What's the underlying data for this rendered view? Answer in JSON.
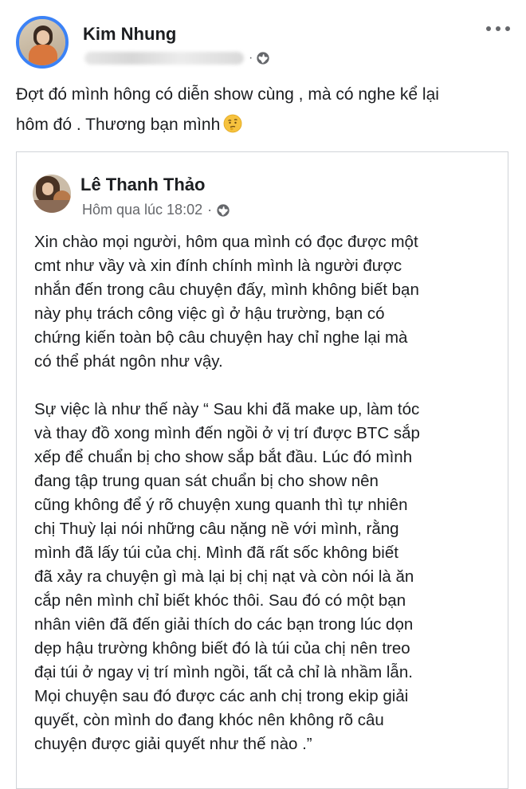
{
  "post": {
    "author": "Kim Nhung",
    "dot": "·",
    "text_lines": [
      "Đợt đó mình hông có diễn show cùng , mà có nghe kể lại",
      "hôm đó . Thương bạn mình"
    ]
  },
  "shared_post": {
    "author": "Lê Thanh Thảo",
    "timestamp": "Hôm qua lúc 18:02",
    "dot": "·",
    "paragraph1": [
      "Xin chào mọi người, hôm qua mình có đọc được một",
      "cmt như vầy và xin đính chính mình là người được",
      "nhắn đến trong câu chuyện đấy, mình không biết bạn",
      "này phụ trách công việc gì ở hậu trường, bạn có",
      "chứng kiến toàn bộ câu chuyện hay chỉ nghe lại mà",
      "có thể phát ngôn như vậy."
    ],
    "paragraph2": [
      "Sự việc là như thế này “ Sau khi đã make up, làm tóc",
      "và thay đồ xong mình đến ngồi ở vị trí được BTC sắp",
      "xếp để chuẩn bị cho show sắp bắt đầu. Lúc đó mình",
      "đang tập trung quan sát chuẩn bị cho show nên",
      "cũng không để ý rõ chuyện xung quanh thì tự nhiên",
      "chị Thuỳ lại nói những câu nặng nề với mình, rằng",
      "mình đã lấy túi của chị. Mình đã rất sốc không biết",
      "đã xảy ra chuyện gì mà lại bị chị nạt và còn nói là ăn",
      "cắp nên mình chỉ biết khóc thôi. Sau đó có một bạn",
      "nhân viên đã đến giải thích do các bạn trong lúc dọn",
      "dẹp hậu trường không biết đó là túi của chị nên treo",
      "đại túi ở ngay vị trí mình ngồi, tất cả chỉ là nhầm lẫn.",
      "Mọi chuyện sau đó được các anh chị trong ekip giải",
      "quyết, còn mình do đang khóc nên không rõ câu",
      "chuyện được giải quyết như thế nào .”"
    ]
  },
  "icons": {
    "more": "more-horizontal-icon",
    "globe": "globe-icon",
    "emoji": "thinking-face-emoji"
  }
}
